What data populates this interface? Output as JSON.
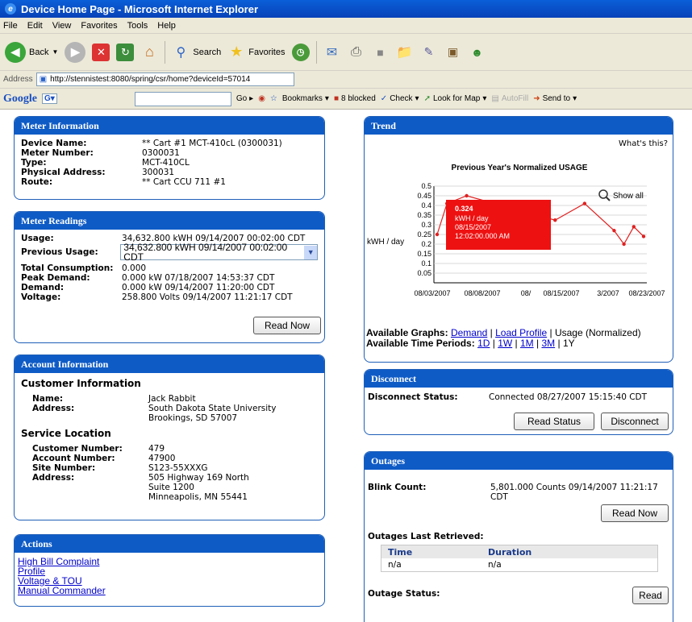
{
  "window": {
    "title": "Device Home Page - Microsoft Internet Explorer"
  },
  "menu": [
    "File",
    "Edit",
    "View",
    "Favorites",
    "Tools",
    "Help"
  ],
  "toolbar": {
    "back": "Back",
    "search": "Search",
    "favorites": "Favorites"
  },
  "address": {
    "label": "Address",
    "url": "http://stennistest:8080/spring/csr/home?deviceId=57014"
  },
  "google": {
    "logo": "Google",
    "go": "Go",
    "bookmarks": "Bookmarks",
    "blocked": "8 blocked",
    "check": "Check",
    "lookmap": "Look for Map",
    "autofill": "AutoFill",
    "sendto": "Send to"
  },
  "meter_info": {
    "title": "Meter Information",
    "rows": [
      {
        "label": "Device Name:",
        "value": "** Cart #1 MCT-410cL (0300031)"
      },
      {
        "label": "Meter Number:",
        "value": "0300031"
      },
      {
        "label": "Type:",
        "value": "MCT-410CL"
      },
      {
        "label": "Physical Address:",
        "value": "300031"
      },
      {
        "label": "Route:",
        "value": "** Cart CCU 711 #1"
      }
    ]
  },
  "meter_readings": {
    "title": "Meter Readings",
    "usage_label": "Usage:",
    "usage_value": "34,632.800 kWH 09/14/2007 00:02:00 CDT",
    "prev_label": "Previous Usage:",
    "prev_value": "34,632.800 kWH 09/14/2007 00:02:00 CDT",
    "rows": [
      {
        "label": "Total Consumption:",
        "value": "0.000"
      },
      {
        "label": "Peak Demand:",
        "value": "0.000 kW 07/18/2007 14:53:37 CDT"
      },
      {
        "label": "Demand:",
        "value": "0.000 kW 09/14/2007 11:20:00 CDT"
      },
      {
        "label": "Voltage:",
        "value": "258.800 Volts 09/14/2007 11:21:17 CDT"
      }
    ],
    "read_now": "Read Now"
  },
  "account": {
    "title": "Account Information",
    "customer_heading": "Customer Information",
    "name_label": "Name:",
    "name_value": "Jack Rabbit",
    "address_label": "Address:",
    "address_lines": [
      "South Dakota State University",
      "Brookings, SD 57007"
    ],
    "service_heading": "Service Location",
    "cust_num_label": "Customer Number:",
    "cust_num": "479",
    "acct_num_label": "Account Number:",
    "acct_num": "47900",
    "site_label": "Site Number:",
    "site": "S123-55XXXG",
    "svc_addr_label": "Address:",
    "svc_addr_lines": [
      "505 Highway 169 North",
      "Suite 1200",
      "Minneapolis, MN 55441"
    ]
  },
  "actions": {
    "title": "Actions",
    "links": [
      "High Bill Complaint",
      "Profile",
      "Voltage & TOU",
      "Manual Commander"
    ]
  },
  "trend": {
    "title": "Trend",
    "whats_this": "What's this?",
    "show_all": "Show all",
    "graphs_label": "Available Graphs:",
    "graph_demand": "Demand",
    "graph_load": "Load Profile",
    "graph_usage": "Usage (Normalized)",
    "periods_label": "Available Time Periods:",
    "periods": [
      "1D",
      "1W",
      "1M",
      "3M"
    ],
    "period_current": "1Y",
    "tooltip": {
      "value": "0.324",
      "unit": "kWH / day",
      "date": "08/15/2007",
      "time": "12:02:00.000 AM"
    }
  },
  "chart_data": {
    "type": "line",
    "title": "Previous Year's Normalized USAGE",
    "xlabel": "",
    "ylabel": "kWH / day",
    "ylim": [
      0,
      0.5
    ],
    "yticks": [
      "0.05",
      "0.1",
      "0.15",
      "0.2",
      "0.25",
      "0.3",
      "0.35",
      "0.4",
      "0.45",
      "0.5"
    ],
    "xticklabels": [
      "08/03/2007",
      "08/08/2007",
      "08/",
      "08/15/2007",
      "3/2007",
      "08/23/2007"
    ],
    "x": [
      "08/03/2007",
      "08/04/2007",
      "08/06/2007",
      "08/15/2007",
      "08/18/2007",
      "08/21/2007",
      "08/22/2007",
      "08/23/2007",
      "08/24/2007"
    ],
    "series": [
      {
        "values": [
          0.25,
          0.41,
          0.45,
          0.324,
          0.41,
          0.27,
          0.2,
          0.29,
          0.24
        ]
      }
    ],
    "grid": true,
    "color": "#e02020"
  },
  "disconnect": {
    "title": "Disconnect",
    "status_label": "Disconnect Status:",
    "status_value": "Connected 08/27/2007 15:15:40 CDT",
    "read_status": "Read Status",
    "disconnect": "Disconnect"
  },
  "outages": {
    "title": "Outages",
    "blink_label": "Blink Count:",
    "blink_value": "5,801.000 Counts 09/14/2007 11:21:17 CDT",
    "read_now": "Read Now",
    "last_retrieved": "Outages Last Retrieved:",
    "col_time": "Time",
    "col_duration": "Duration",
    "time": "n/a",
    "duration": "n/a",
    "status_label": "Outage Status:",
    "read": "Read"
  }
}
